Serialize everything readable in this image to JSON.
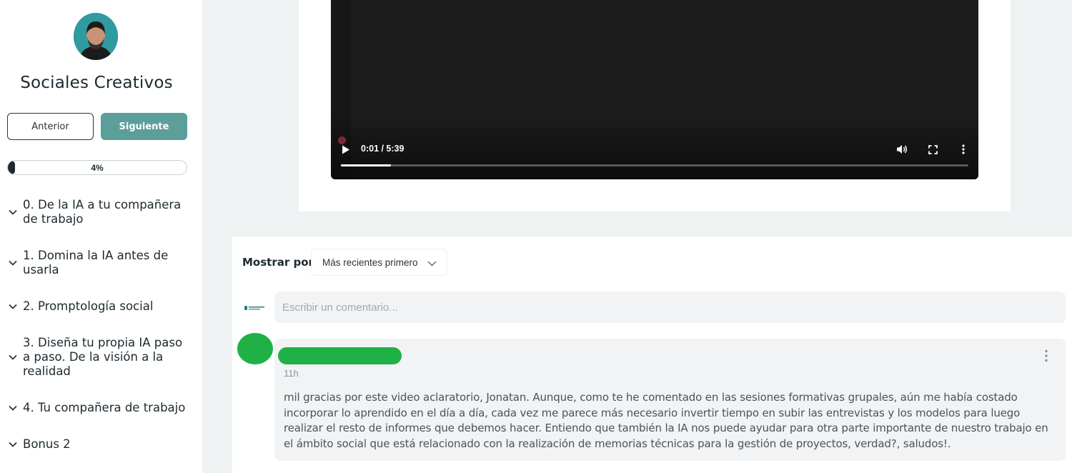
{
  "sidebar": {
    "course_title": "Sociales Creativos",
    "prev_label": "Anterior",
    "next_label": "Siguiente",
    "progress_label": "4%",
    "progress_value": 0.04,
    "sections": [
      {
        "label": "0. De la IA a tu compañera de trabajo"
      },
      {
        "label": "1. Domina la IA antes de usarla"
      },
      {
        "label": "2. Promptología social"
      },
      {
        "label": "3. Diseña tu propia IA paso a paso. De la visión a la realidad"
      },
      {
        "label": "4. Tu compañera de trabajo"
      },
      {
        "label": "Bonus 2"
      }
    ]
  },
  "video": {
    "time_display": "0:01 / 5:39",
    "played_fraction": 0.08,
    "icons": [
      "play-icon",
      "volume-icon",
      "fullscreen-icon",
      "more-options-icon"
    ]
  },
  "comments": {
    "sort_label": "Mostrar por",
    "sort_value": "Más recientes primero",
    "input_placeholder": "Escribir un comentario...",
    "items": [
      {
        "time": "11h",
        "text": "mil gracias por este video aclaratorio, Jonatan. Aunque, como te he comentado en las sesiones formativas grupales, aún me había costado incorporar lo aprendido en el día a día, cada vez me parece más necesario invertir tiempo en subir las entrevistas y los modelos para luego realizar el resto de informes que debemos hacer. Entiendo que también la IA nos puede ayudar para otra parte importante de nuestro trabajo en el ámbito social que está relacionado con la realización de memorias técnicas para la gestión de proyectos, verdad?, saludos!."
      }
    ]
  },
  "colors": {
    "accent": "#5c9e9a",
    "panel_bg": "#eef2f3",
    "redaction": "#1fb146"
  }
}
